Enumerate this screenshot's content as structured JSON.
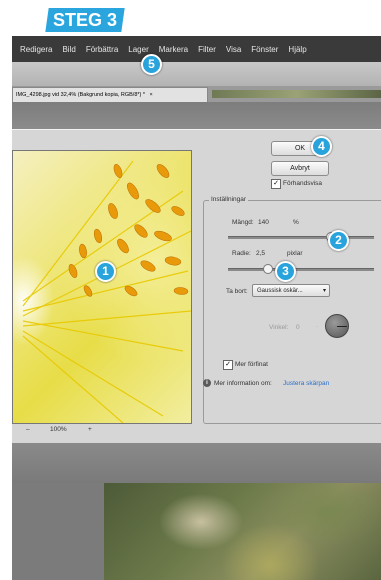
{
  "step_label": "STEG 3",
  "menu": [
    "Redigera",
    "Bild",
    "Förbättra",
    "Lager",
    "Markera",
    "Filter",
    "Visa",
    "Fönster",
    "Hjälp"
  ],
  "tab": {
    "title": "IMG_4298.jpg vid 32,4% (Bakgrund kopia, RGB/8*) *",
    "close": "×"
  },
  "dialog": {
    "ok_label": "OK",
    "cancel_label": "Avbryt",
    "preview_label": "Förhandsvisa",
    "preview_checked": true,
    "group_title": "Inställningar",
    "amount_label": "Mängd:",
    "amount_value": "140",
    "amount_unit": "%",
    "amount_fraction": 0.7,
    "radius_label": "Radie:",
    "radius_value": "2,5",
    "radius_unit": "pixlar",
    "radius_fraction": 0.27,
    "remove_label": "Ta bort:",
    "remove_value": "Gaussisk oskär...",
    "angle_label": "Vinkel:",
    "angle_value": "0",
    "finer_label": "Mer förfinat",
    "finer_checked": true,
    "info_label": "Mer information om:",
    "info_link": "Justera skärpan",
    "zoom_minus": "–",
    "zoom_value": "100%",
    "zoom_plus": "+"
  },
  "callouts": [
    "1",
    "2",
    "3",
    "4",
    "5"
  ],
  "colors": {
    "badge": "#29a3dc",
    "step_bg": "#2aa5de",
    "menubar": "#3a3a3a",
    "link": "#2a6fc9"
  }
}
